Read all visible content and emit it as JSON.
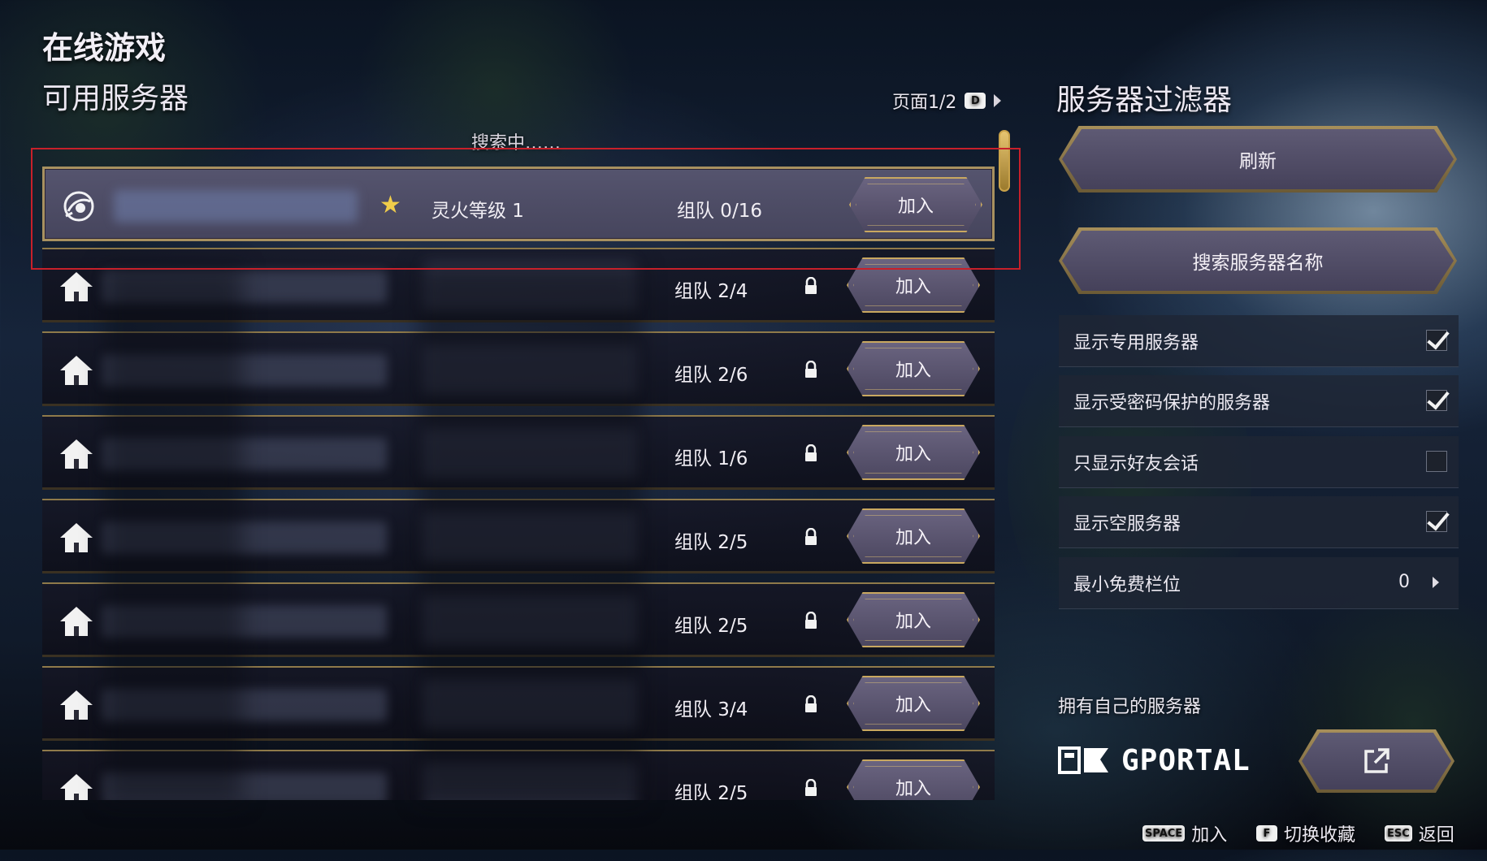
{
  "header": {
    "title": "在线游戏",
    "subtitle": "可用服务器",
    "page_label": "页面1/2",
    "page_key": "D",
    "searching": "搜索中……"
  },
  "servers": [
    {
      "icon": "spirit-icon",
      "favorite": true,
      "level": "灵火等级 1",
      "players": "组队 0/16",
      "locked": false,
      "join": "加入"
    },
    {
      "icon": "home-icon",
      "favorite": false,
      "level": "",
      "players": "组队 2/4",
      "locked": true,
      "join": "加入"
    },
    {
      "icon": "home-icon",
      "favorite": false,
      "level": "",
      "players": "组队 2/6",
      "locked": true,
      "join": "加入"
    },
    {
      "icon": "home-icon",
      "favorite": false,
      "level": "",
      "players": "组队 1/6",
      "locked": true,
      "join": "加入"
    },
    {
      "icon": "home-icon",
      "favorite": false,
      "level": "",
      "players": "组队 2/5",
      "locked": true,
      "join": "加入"
    },
    {
      "icon": "home-icon",
      "favorite": false,
      "level": "",
      "players": "组队 2/5",
      "locked": true,
      "join": "加入"
    },
    {
      "icon": "home-icon",
      "favorite": false,
      "level": "",
      "players": "组队 3/4",
      "locked": true,
      "join": "加入"
    },
    {
      "icon": "home-icon",
      "favorite": false,
      "level": "",
      "players": "组队 2/5",
      "locked": true,
      "join": "加入"
    }
  ],
  "filters": {
    "title": "服务器过滤器",
    "refresh": "刷新",
    "search_name": "搜索服务器名称",
    "options": [
      {
        "label": "显示专用服务器",
        "checked": true
      },
      {
        "label": "显示受密码保护的服务器",
        "checked": true
      },
      {
        "label": "只显示好友会话",
        "checked": false
      },
      {
        "label": "显示空服务器",
        "checked": true
      }
    ],
    "min_free_slots_label": "最小免费栏位",
    "min_free_slots_value": "0"
  },
  "own_server": {
    "label": "拥有自己的服务器",
    "brand": "GPORTAL"
  },
  "footer": {
    "join_key": "SPACE",
    "join_label": "加入",
    "fav_key": "F",
    "fav_label": "切换收藏",
    "back_key": "ESC",
    "back_label": "返回"
  },
  "colors": {
    "accent_gold": "#c9a860",
    "highlight_red": "#c8202a",
    "star": "#f0cd4a"
  }
}
